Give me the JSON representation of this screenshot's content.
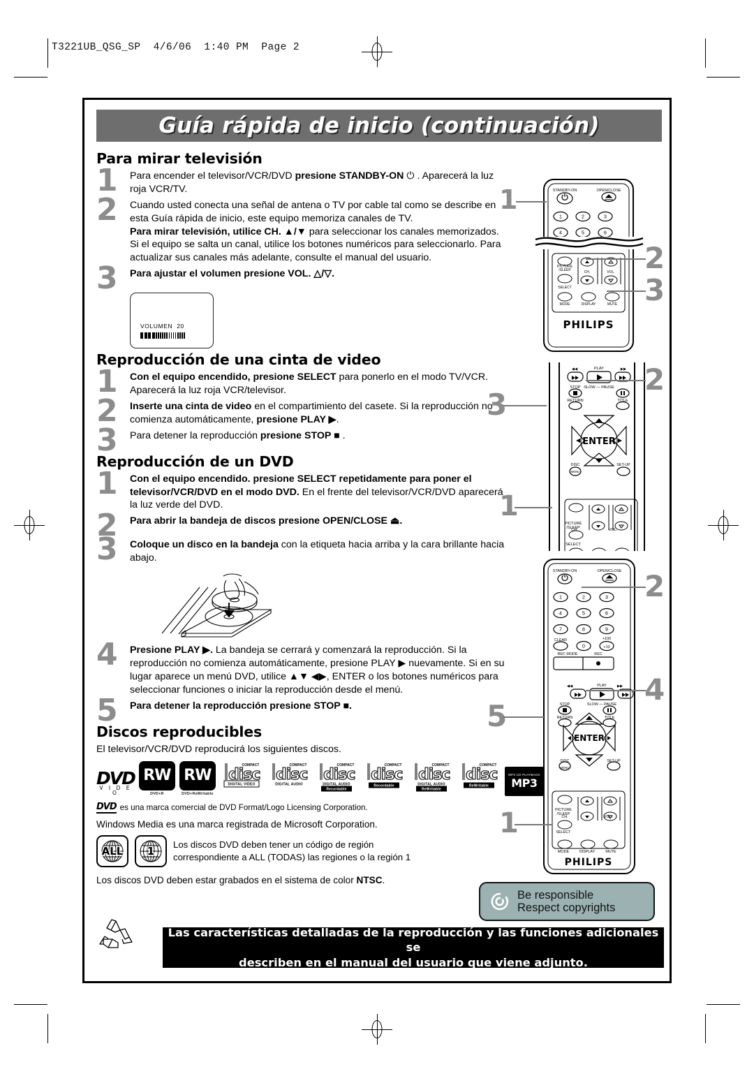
{
  "slug": "T3221UB_QSG_SP  4/6/06  1:40 PM  Page 2",
  "banner": {
    "title": "Guía rápida de inicio (continuación)"
  },
  "sections": {
    "tv": {
      "heading": "Para mirar televisión",
      "steps": [
        {
          "num": "1",
          "html": "Para encender el televisor/VCR/DVD <b>presione STANDBY-ON</b> ⏻ . Aparecerá la luz roja VCR/TV."
        },
        {
          "num": "2",
          "html": "Cuando usted conecta una señal de antena o TV por cable tal como se describe en esta Guía rápida de inicio, este equipo memoriza canales de TV.<br><b>Para mirar televisión, utilice CH. ▲/▼</b> para seleccionar los canales memorizados. Si el equipo se salta un canal, utilice los botones numéricos para seleccionarlo. Para actualizar sus canales más adelante, consulte el manual del usuario."
        },
        {
          "num": "3",
          "html": "<b>Para ajustar el volumen presione VOL. △/▽.</b>"
        }
      ]
    },
    "osd": {
      "label": "VOLUMEN",
      "value": "20",
      "filled_blocks": 4,
      "thin_blocks": 14
    },
    "tape": {
      "heading": "Reproducción de una cinta de video",
      "steps": [
        {
          "num": "1",
          "html": "<b>Con el equipo encendido, presione SELECT</b> para ponerlo en el modo TV/VCR. Aparecerá la luz roja VCR/televisor."
        },
        {
          "num": "2",
          "html": "<b>Inserte una cinta de video</b> en el compartimiento del casete. Si la reproducción no comienza automáticamente, <b>presione PLAY ▶</b>."
        },
        {
          "num": "3",
          "html": "Para detener la reproducción <b>presione STOP ■</b> ."
        }
      ]
    },
    "dvd": {
      "heading": "Reproducción de un DVD",
      "steps": [
        {
          "num": "1",
          "html": "<b>Con el equipo encendido. presione SELECT repetidamente para poner el televisor/VCR/DVD en el modo DVD.</b> En el frente del televisor/VCR/DVD aparecerá la luz verde del DVD."
        },
        {
          "num": "2",
          "html": "<b>Para abrir la bandeja de discos presione OPEN/CLOSE ⏏.</b>"
        },
        {
          "num": "3",
          "html": "<b>Coloque un disco en la bandeja</b> con la etiqueta hacia arriba y la cara brillante hacia abajo."
        },
        {
          "num": "4",
          "html": "<b>Presione PLAY ▶.</b> La bandeja se cerrará y comenzará la reproducción. Si la reproducción no comienza automáticamente, presione PLAY ▶ nuevamente. Si en su lugar aparece un menú DVD, utilice ▲▼ ◀▶, ENTER o los botones numéricos para seleccionar funciones o iniciar la reproducción desde el menú."
        },
        {
          "num": "5",
          "html": "<b>Para detener la reproducción presione STOP ■.</b>"
        }
      ]
    },
    "discs": {
      "heading": "Discos reproducibles",
      "intro": "El televisor/VCR/DVD  reproducirá los siguientes discos.",
      "logos": [
        {
          "type": "dvd-video",
          "main": "DVD",
          "sub": "V I D E O",
          "caption": ""
        },
        {
          "type": "rw",
          "main": "RW",
          "caption": "DVD+R"
        },
        {
          "type": "rw",
          "main": "RW",
          "caption": "DVD+ReWritable"
        },
        {
          "type": "cd",
          "top": "COMPACT",
          "main": "disc",
          "sub": "DIGITAL VIDEO",
          "sub2": "",
          "inverted": false,
          "boxed": true
        },
        {
          "type": "cd",
          "top": "COMPACT",
          "main": "disc",
          "sub": "DIGITAL AUDIO",
          "sub2": "",
          "inverted": false,
          "boxed": false
        },
        {
          "type": "cd",
          "top": "COMPACT",
          "main": "disc",
          "sub": "DIGITAL AUDIO",
          "sub2": "Recordable",
          "inverted": true,
          "boxed": false
        },
        {
          "type": "cd",
          "top": "COMPACT",
          "main": "disc",
          "sub": "",
          "sub2": "Recordable",
          "inverted": true,
          "boxed": false
        },
        {
          "type": "cd",
          "top": "COMPACT",
          "main": "disc",
          "sub": "DIGITAL AUDIO",
          "sub2": "ReWritable",
          "inverted": true,
          "boxed": false
        },
        {
          "type": "cd",
          "top": "COMPACT",
          "main": "disc",
          "sub": "",
          "sub2": "ReWritable",
          "inverted": true,
          "boxed": false
        },
        {
          "type": "mp3",
          "top": "MP3 CD PLAYBACK",
          "main": "MP3",
          "caption": ""
        }
      ],
      "trademark": "es una marca comercial de DVD Format/Logo Licensing Corporation.",
      "trademark_mark": "DVD",
      "windows_media": "Windows Media es una marca registrada de Microsoft Corporation."
    },
    "region": {
      "codes": [
        "ALL",
        "1"
      ],
      "text_line1": "Los discos DVD deben tener un código de región",
      "text_line2": "correspondiente a ALL (TODAS) las regiones o la región 1",
      "ntsc_pre": "Los discos DVD deben estar grabados en el sistema de color ",
      "ntsc_bold": "NTSC",
      "ntsc_post": "."
    },
    "badge": {
      "line1": "Be responsible",
      "line2": "Respect copyrights"
    },
    "footer": {
      "line1": "Las características detalladas de la reproducción y las funciones adicionales se",
      "line2": "describen en el manual del usuario que viene adjunto."
    }
  },
  "callouts": [
    {
      "id": "c1",
      "label": "1"
    },
    {
      "id": "c2",
      "label": "2"
    },
    {
      "id": "c3",
      "label": "3"
    },
    {
      "id": "c4",
      "label": "2"
    },
    {
      "id": "c5",
      "label": "3"
    },
    {
      "id": "c6",
      "label": "1"
    },
    {
      "id": "c7",
      "label": "2"
    },
    {
      "id": "c8",
      "label": "4"
    },
    {
      "id": "c9",
      "label": "5"
    },
    {
      "id": "c10",
      "label": "1"
    }
  ],
  "remote": {
    "brand": "PHILIPS",
    "labels": {
      "standby": "STANDBY-ON",
      "open_close": "OPEN/CLOSE",
      "picture_sleep_1": "PICTURE",
      "picture_sleep_2": "/SLEEP",
      "select": "SELECT",
      "ch": "CH.",
      "vol": "VOL.",
      "mode": "MODE",
      "display": "DISPLAY",
      "mute": "MUTE",
      "play": "PLAY",
      "stop": "STOP",
      "slow": "SLOW",
      "pause": "PAUSE",
      "return": "RETURN",
      "title": "TITLE",
      "enter": "ENTER",
      "disc": "DISC",
      "menu": "MENU",
      "setup": "SET-UP",
      "clear": "CLEAR",
      "plus100": "+100",
      "plus10": "+10",
      "rec_mode": "REC MODE",
      "rec": "REC"
    },
    "keys": [
      "1",
      "2",
      "3",
      "4",
      "5",
      "6",
      "7",
      "8",
      "9",
      "0"
    ]
  },
  "colors": {
    "banner_bg": "#6e6e6e",
    "step_number": "#8c8c8c",
    "badge_bg": "#9cb2b2",
    "footer_bg": "#000000"
  }
}
